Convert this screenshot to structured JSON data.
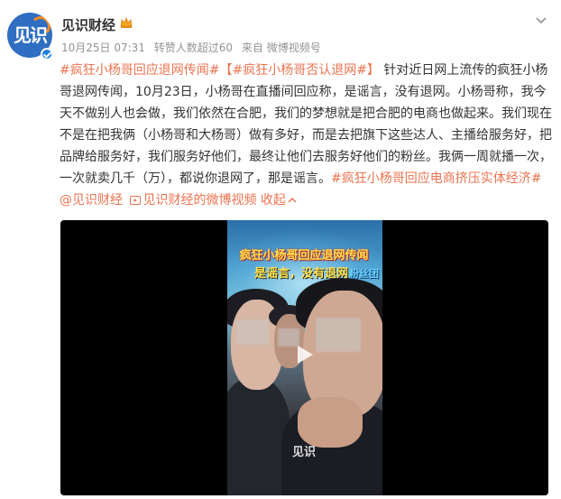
{
  "account": {
    "name": "见识财经",
    "avatar_text": "见识",
    "verified": true
  },
  "meta": {
    "time": "10月25日 07:31",
    "reposts": "转赞人数超过60",
    "source": "来自 微博视频号"
  },
  "post": {
    "tag1": "#疯狂小杨哥回应退网传闻#",
    "tag2": "【#疯狂小杨哥否认退网#】",
    "text": "针对近日网上流传的疯狂小杨哥退网传闻，10月23日，小杨哥在直播间回应称，是谣言，没有退网。小杨哥称，我今天不做别人也会做，我们依然在合肥，我们的梦想就是把合肥的电商也做起来。我们现在不是在把我俩（小杨哥和大杨哥）做有多好，而是去把旗下这些达人、主播给服务好，把品牌给服务好，我们服务好他们，最终让他们去服务好他们的粉丝。我俩一周就播一次，一次就卖几千（万），都说你退网了，那是谣言。",
    "tag3": "#疯狂小杨哥回应电商挤压实体经济#",
    "mention": "@见识财经",
    "video_link": "见识财经的微博视频",
    "collapse_label": "收起"
  },
  "video": {
    "caption_line1": "疯狂小杨哥回应退网传闻",
    "caption_line2": "是谣言，没有退网",
    "caption_line2_extra": "粉丝团",
    "watermark": "见识"
  },
  "icons": {
    "crown": "crown-icon",
    "more": "chevron-down-icon",
    "play": "play-icon",
    "video_link": "video-link-icon"
  },
  "colors": {
    "link": "#eb7350",
    "avatar_bg": "#2f6ec1",
    "verified": "#1b7fe0",
    "caption_yellow": "#ffe34d"
  }
}
